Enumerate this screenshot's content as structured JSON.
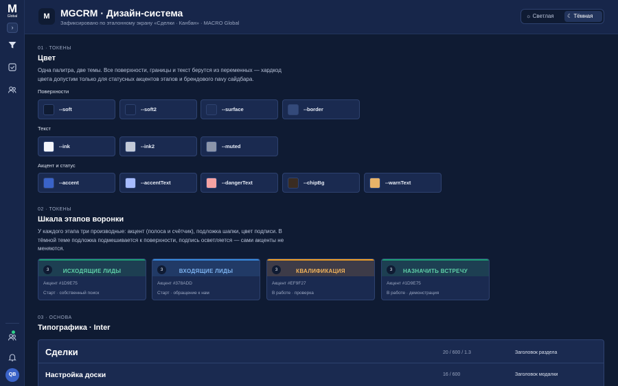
{
  "rail": {
    "logo_letter": "M",
    "logo_sub": "Global",
    "toggle": "›",
    "icons": [
      "filter-icon",
      "tasks-icon",
      "users-icon",
      "team-icon",
      "bell-icon"
    ],
    "avatar": "QB"
  },
  "header": {
    "logo": "M",
    "title": "MGCRM · Дизайн-система",
    "subtitle": "Зафиксировано по эталонному экрану «Сделки · Канбан» · MACRO Global",
    "theme_light": "Светлая",
    "theme_dark": "Тёмная"
  },
  "tokens": {
    "eyebrow": "01 · ТОКЕНЫ",
    "title": "Цвет",
    "desc_line1": "Одна палитра, две темы. Все поверхности, границы и текст берутся из переменных — хардкод",
    "desc_line2": "цвета допустим только для статусных акцентов этапов и брендового navy сайдбара.",
    "groups": [
      {
        "label": "Поверхности",
        "items": [
          {
            "name": "--soft",
            "color": "#0f1b33"
          },
          {
            "name": "--soft2",
            "color": "#17264a"
          },
          {
            "name": "--surface",
            "color": "#1e2f57"
          },
          {
            "name": "--border",
            "color": "#344a7a"
          }
        ]
      },
      {
        "label": "Текст",
        "items": [
          {
            "name": "--ink",
            "color": "#f3f5fa"
          },
          {
            "name": "--ink2",
            "color": "#c3cad8"
          },
          {
            "name": "--muted",
            "color": "#8b95aa"
          }
        ]
      },
      {
        "label": "Акцент и статус",
        "items": [
          {
            "name": "--accent",
            "color": "#3a63c8"
          },
          {
            "name": "--accentText",
            "color": "#a7bcff"
          },
          {
            "name": "--dangerText",
            "color": "#f5a3a3"
          },
          {
            "name": "--chipBg",
            "color": "#3a2c22"
          },
          {
            "name": "--warnText",
            "color": "#e8b368"
          }
        ]
      }
    ]
  },
  "stages": {
    "eyebrow": "02 · ТОКЕНЫ",
    "title": "Шкала этапов воронки",
    "desc_line1": "У каждого этапа три производные: акцент (полоса и счётчик), подложка шапки, цвет подписи. В",
    "desc_line2": "тёмной теме подложка подмешивается к поверхности, подпись осветляется — сами акценты не",
    "desc_line3": "меняются.",
    "items": [
      {
        "count": "3",
        "name": "ИСХОДЯЩИЕ ЛИДЫ",
        "accent_label": "Акцент #1D9E75",
        "note": "Старт · собственный поиск",
        "accent": "#1D9E75",
        "head_bg": "#1d3f52",
        "text": "#5fd1a8"
      },
      {
        "count": "3",
        "name": "ВХОДЯЩИЕ ЛИДЫ",
        "accent_label": "Акцент #378ADD",
        "note": "Старт · обращение к нам",
        "accent": "#378ADD",
        "head_bg": "#213a66",
        "text": "#7db3f0"
      },
      {
        "count": "3",
        "name": "КВАЛИФИКАЦИЯ",
        "accent_label": "Акцент #EF9F27",
        "note": "В работе · проверка",
        "accent": "#EF9F27",
        "head_bg": "#3d3b48",
        "text": "#f3b45a"
      },
      {
        "count": "3",
        "name": "НАЗНАЧИТЬ ВСТРЕЧУ",
        "accent_label": "Акцент #1D9E75",
        "note": "В работе · демонстрация",
        "accent": "#1D9E75",
        "head_bg": "#1d3f52",
        "text": "#5fd1a8"
      }
    ]
  },
  "typography": {
    "eyebrow": "03 · ОСНОВА",
    "title": "Типографика · Inter",
    "rows": [
      {
        "sample": "Сделки",
        "meta": "20 / 600 / 1.3",
        "role": "Заголовок раздела"
      },
      {
        "sample": "Настройка доски",
        "meta": "16 / 600",
        "role": "Заголовок модалки"
      }
    ]
  }
}
